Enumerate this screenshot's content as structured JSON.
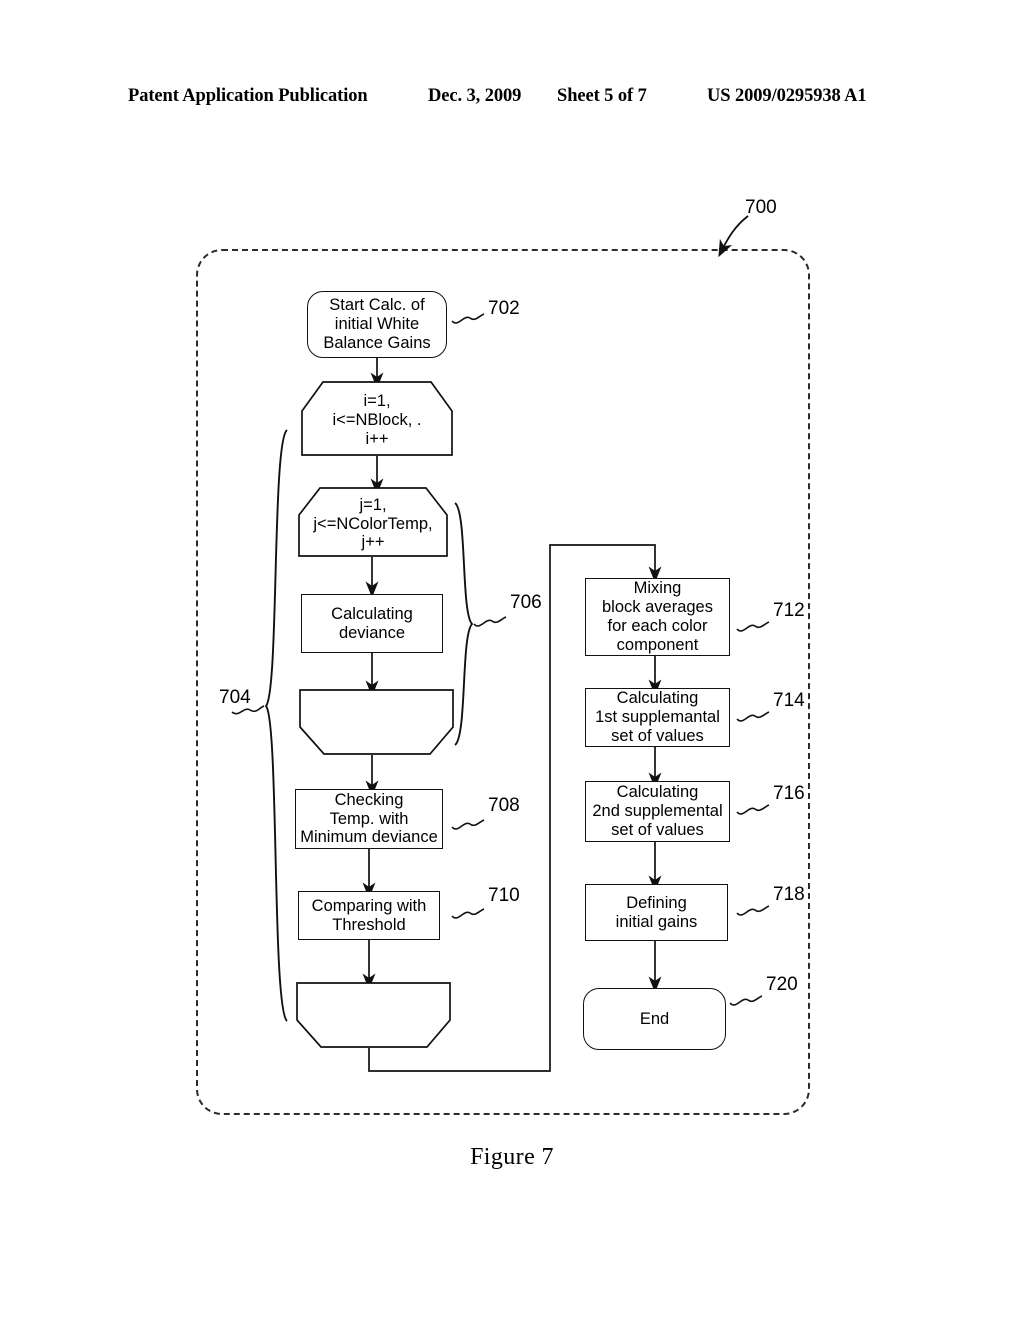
{
  "header": {
    "publication": "Patent Application Publication",
    "date": "Dec. 3, 2009",
    "sheet": "Sheet 5 of 7",
    "number": "US 2009/0295938 A1"
  },
  "caption": "Figure 7",
  "diagram": {
    "container_ref": "700",
    "nodes": [
      {
        "ref": "702",
        "shape": "terminator",
        "label": "Start Calc. of\ninitial White\nBalance Gains"
      },
      {
        "ref": "",
        "shape": "loop-start",
        "label": "i=1,\ni<=NBlock, .\ni++"
      },
      {
        "ref": "",
        "shape": "loop-start",
        "label": "j=1,\nj<=NColorTemp,\nj++"
      },
      {
        "ref": "706",
        "shape": "process",
        "label": "Calculating\ndeviance"
      },
      {
        "ref": "",
        "shape": "loop-end",
        "label": ""
      },
      {
        "ref": "708",
        "shape": "process",
        "label": "Checking\nTemp. with\nMinimum deviance"
      },
      {
        "ref": "710",
        "shape": "process",
        "label": "Comparing with\nThreshold"
      },
      {
        "ref": "",
        "shape": "loop-end",
        "label": ""
      },
      {
        "ref": "712",
        "shape": "process",
        "label": "Mixing\nblock averages\nfor each color\ncomponent"
      },
      {
        "ref": "714",
        "shape": "process",
        "label": "Calculating\n1st supplemantal\nset of values"
      },
      {
        "ref": "716",
        "shape": "process",
        "label": "Calculating\n2nd supplemental\nset of values"
      },
      {
        "ref": "718",
        "shape": "process",
        "label": "Defining\ninitial gains"
      },
      {
        "ref": "720",
        "shape": "terminator",
        "label": "End"
      }
    ],
    "braces": [
      {
        "ref": "704",
        "spans": "outer loop i"
      },
      {
        "ref": "706",
        "spans": "inner loop j"
      }
    ],
    "refs": {
      "r700": "700",
      "r702": "702",
      "r704": "704",
      "r706": "706",
      "r708": "708",
      "r710": "710",
      "r712": "712",
      "r714": "714",
      "r716": "716",
      "r718": "718",
      "r720": "720"
    },
    "labels": {
      "start": "Start Calc. of initial White Balance Gains",
      "loop_i_l1": "i=1,",
      "loop_i_l2": "i<=NBlock, .",
      "loop_i_l3": "i++",
      "loop_j_l1": "j=1,",
      "loop_j_l2": "j<=NColorTemp,",
      "loop_j_l3": "j++",
      "calc_dev_l1": "Calculating",
      "calc_dev_l2": "deviance",
      "check_l1": "Checking",
      "check_l2": "Temp. with",
      "check_l3": "Minimum deviance",
      "compare_l1": "Comparing with",
      "compare_l2": "Threshold",
      "mixing_l1": "Mixing",
      "mixing_l2": "block averages",
      "mixing_l3": "for each color",
      "mixing_l4": "component",
      "first_l1": "Calculating",
      "first_l2": "1st supplemantal",
      "first_l3": "set of values",
      "second_l1": "Calculating",
      "second_l2": "2nd supplemental",
      "second_l3": "set of values",
      "define_l1": "Defining",
      "define_l2": "initial gains",
      "end": "End"
    },
    "colors": {
      "line": "#111111",
      "container_border": "#2b2b2b",
      "background": "#ffffff"
    }
  }
}
